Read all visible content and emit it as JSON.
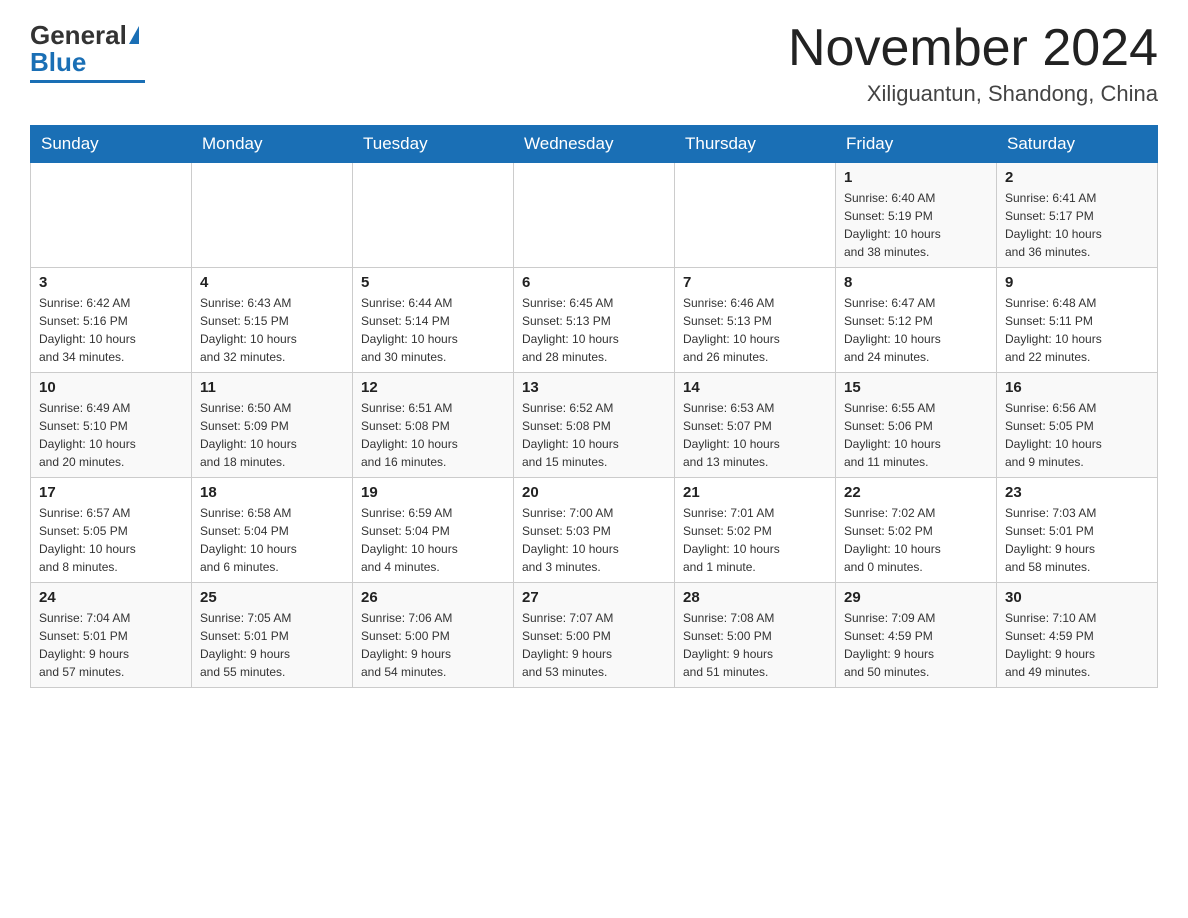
{
  "header": {
    "logo_general": "General",
    "logo_blue": "Blue",
    "title": "November 2024",
    "subtitle": "Xiliguantun, Shandong, China"
  },
  "weekdays": [
    "Sunday",
    "Monday",
    "Tuesday",
    "Wednesday",
    "Thursday",
    "Friday",
    "Saturday"
  ],
  "weeks": [
    {
      "days": [
        {
          "num": "",
          "info": ""
        },
        {
          "num": "",
          "info": ""
        },
        {
          "num": "",
          "info": ""
        },
        {
          "num": "",
          "info": ""
        },
        {
          "num": "",
          "info": ""
        },
        {
          "num": "1",
          "info": "Sunrise: 6:40 AM\nSunset: 5:19 PM\nDaylight: 10 hours\nand 38 minutes."
        },
        {
          "num": "2",
          "info": "Sunrise: 6:41 AM\nSunset: 5:17 PM\nDaylight: 10 hours\nand 36 minutes."
        }
      ]
    },
    {
      "days": [
        {
          "num": "3",
          "info": "Sunrise: 6:42 AM\nSunset: 5:16 PM\nDaylight: 10 hours\nand 34 minutes."
        },
        {
          "num": "4",
          "info": "Sunrise: 6:43 AM\nSunset: 5:15 PM\nDaylight: 10 hours\nand 32 minutes."
        },
        {
          "num": "5",
          "info": "Sunrise: 6:44 AM\nSunset: 5:14 PM\nDaylight: 10 hours\nand 30 minutes."
        },
        {
          "num": "6",
          "info": "Sunrise: 6:45 AM\nSunset: 5:13 PM\nDaylight: 10 hours\nand 28 minutes."
        },
        {
          "num": "7",
          "info": "Sunrise: 6:46 AM\nSunset: 5:13 PM\nDaylight: 10 hours\nand 26 minutes."
        },
        {
          "num": "8",
          "info": "Sunrise: 6:47 AM\nSunset: 5:12 PM\nDaylight: 10 hours\nand 24 minutes."
        },
        {
          "num": "9",
          "info": "Sunrise: 6:48 AM\nSunset: 5:11 PM\nDaylight: 10 hours\nand 22 minutes."
        }
      ]
    },
    {
      "days": [
        {
          "num": "10",
          "info": "Sunrise: 6:49 AM\nSunset: 5:10 PM\nDaylight: 10 hours\nand 20 minutes."
        },
        {
          "num": "11",
          "info": "Sunrise: 6:50 AM\nSunset: 5:09 PM\nDaylight: 10 hours\nand 18 minutes."
        },
        {
          "num": "12",
          "info": "Sunrise: 6:51 AM\nSunset: 5:08 PM\nDaylight: 10 hours\nand 16 minutes."
        },
        {
          "num": "13",
          "info": "Sunrise: 6:52 AM\nSunset: 5:08 PM\nDaylight: 10 hours\nand 15 minutes."
        },
        {
          "num": "14",
          "info": "Sunrise: 6:53 AM\nSunset: 5:07 PM\nDaylight: 10 hours\nand 13 minutes."
        },
        {
          "num": "15",
          "info": "Sunrise: 6:55 AM\nSunset: 5:06 PM\nDaylight: 10 hours\nand 11 minutes."
        },
        {
          "num": "16",
          "info": "Sunrise: 6:56 AM\nSunset: 5:05 PM\nDaylight: 10 hours\nand 9 minutes."
        }
      ]
    },
    {
      "days": [
        {
          "num": "17",
          "info": "Sunrise: 6:57 AM\nSunset: 5:05 PM\nDaylight: 10 hours\nand 8 minutes."
        },
        {
          "num": "18",
          "info": "Sunrise: 6:58 AM\nSunset: 5:04 PM\nDaylight: 10 hours\nand 6 minutes."
        },
        {
          "num": "19",
          "info": "Sunrise: 6:59 AM\nSunset: 5:04 PM\nDaylight: 10 hours\nand 4 minutes."
        },
        {
          "num": "20",
          "info": "Sunrise: 7:00 AM\nSunset: 5:03 PM\nDaylight: 10 hours\nand 3 minutes."
        },
        {
          "num": "21",
          "info": "Sunrise: 7:01 AM\nSunset: 5:02 PM\nDaylight: 10 hours\nand 1 minute."
        },
        {
          "num": "22",
          "info": "Sunrise: 7:02 AM\nSunset: 5:02 PM\nDaylight: 10 hours\nand 0 minutes."
        },
        {
          "num": "23",
          "info": "Sunrise: 7:03 AM\nSunset: 5:01 PM\nDaylight: 9 hours\nand 58 minutes."
        }
      ]
    },
    {
      "days": [
        {
          "num": "24",
          "info": "Sunrise: 7:04 AM\nSunset: 5:01 PM\nDaylight: 9 hours\nand 57 minutes."
        },
        {
          "num": "25",
          "info": "Sunrise: 7:05 AM\nSunset: 5:01 PM\nDaylight: 9 hours\nand 55 minutes."
        },
        {
          "num": "26",
          "info": "Sunrise: 7:06 AM\nSunset: 5:00 PM\nDaylight: 9 hours\nand 54 minutes."
        },
        {
          "num": "27",
          "info": "Sunrise: 7:07 AM\nSunset: 5:00 PM\nDaylight: 9 hours\nand 53 minutes."
        },
        {
          "num": "28",
          "info": "Sunrise: 7:08 AM\nSunset: 5:00 PM\nDaylight: 9 hours\nand 51 minutes."
        },
        {
          "num": "29",
          "info": "Sunrise: 7:09 AM\nSunset: 4:59 PM\nDaylight: 9 hours\nand 50 minutes."
        },
        {
          "num": "30",
          "info": "Sunrise: 7:10 AM\nSunset: 4:59 PM\nDaylight: 9 hours\nand 49 minutes."
        }
      ]
    }
  ]
}
